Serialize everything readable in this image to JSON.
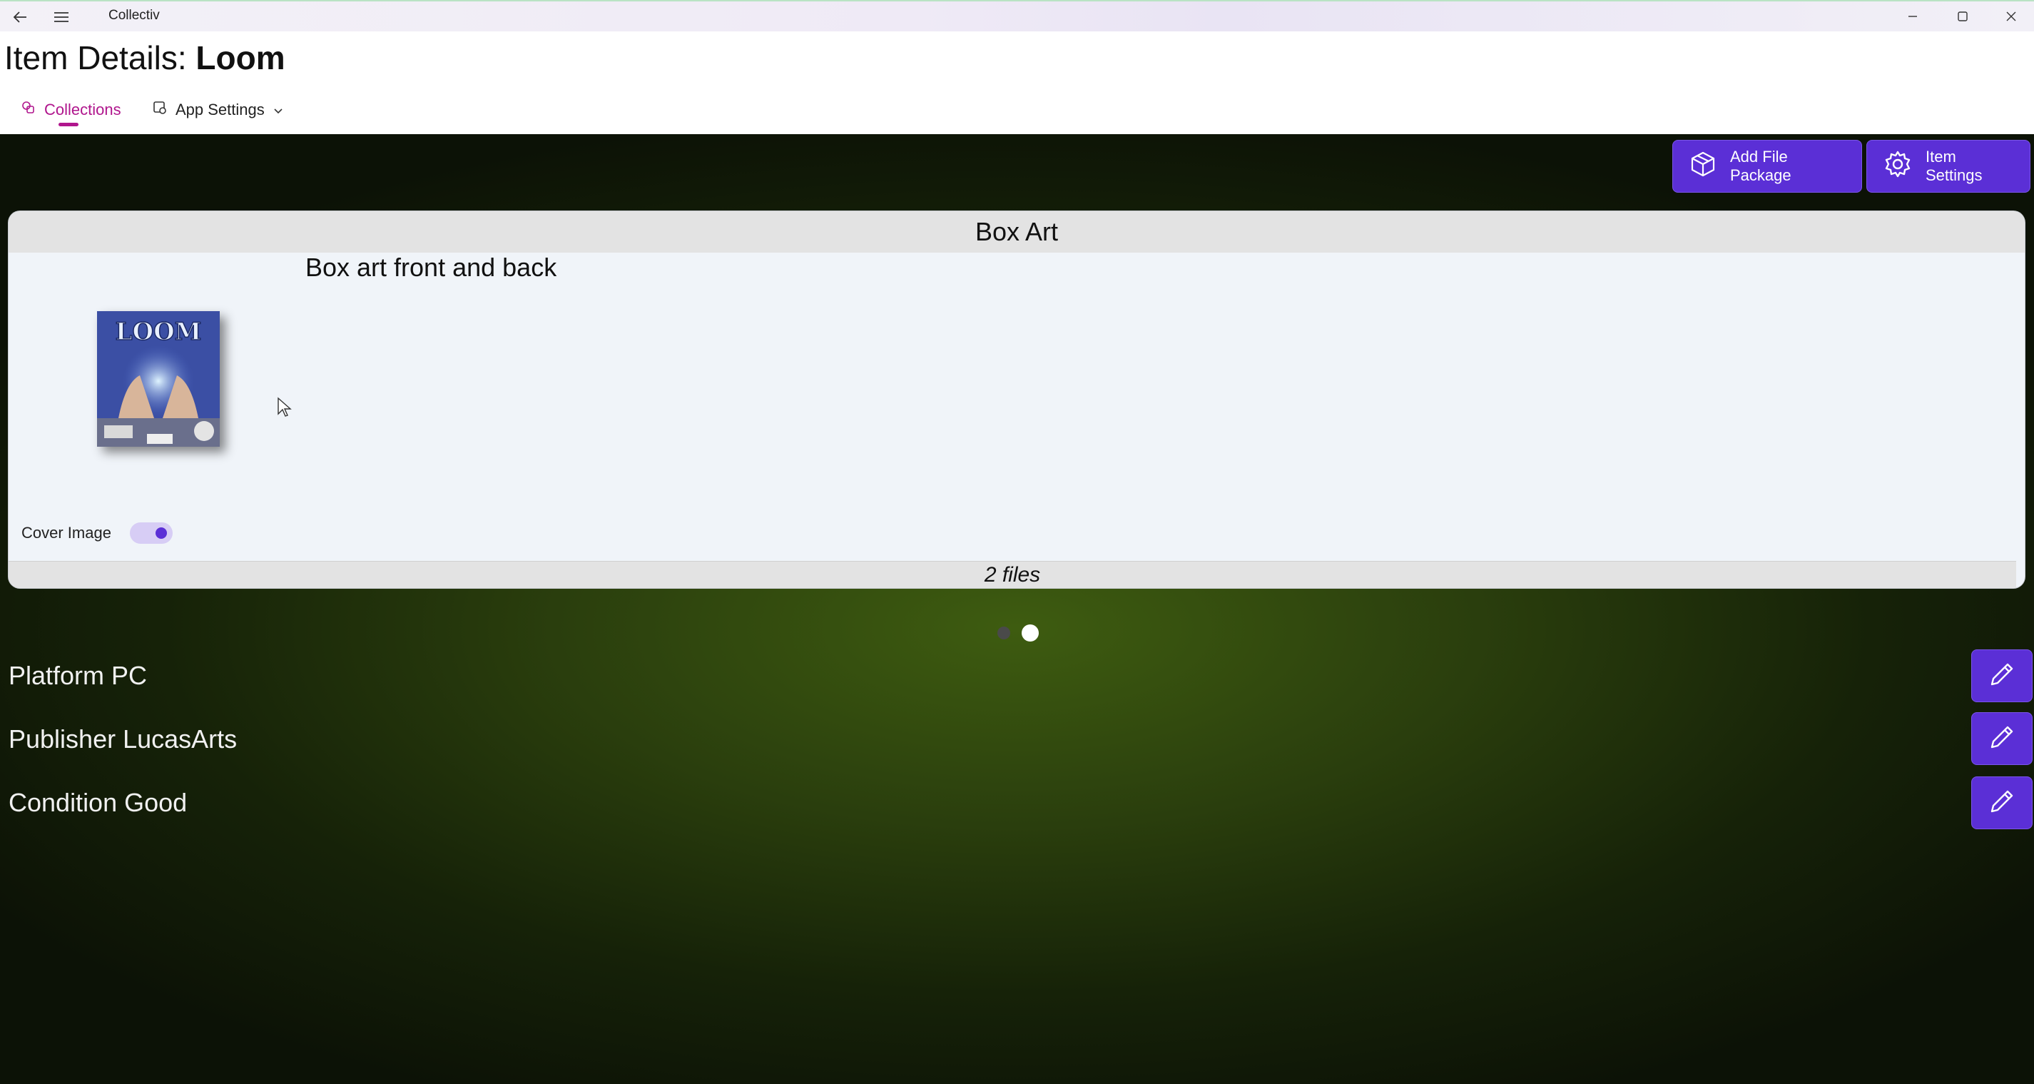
{
  "window": {
    "app_title": "Collectiv",
    "back_icon": "back-arrow-icon",
    "menu_icon": "hamburger-menu-icon",
    "controls": [
      "minimize-icon",
      "maximize-icon",
      "close-icon"
    ]
  },
  "header": {
    "title_prefix": "Item Details: ",
    "title_item": "Loom",
    "tabs": [
      {
        "label": "Collections",
        "icon": "collections-icon",
        "active": true
      },
      {
        "label": "App Settings",
        "icon": "settings-app-icon",
        "active": false
      }
    ]
  },
  "toolbar": {
    "add_file_package_label": "Add File Package",
    "item_settings_label": "Item Settings"
  },
  "file_package": {
    "title": "Box Art",
    "description": "Box art front and back",
    "cover_image_label": "Cover Image",
    "cover_image_on": true,
    "thumbnail_text": "LOOM",
    "file_count": "2 files"
  },
  "pager": {
    "count": 2,
    "active_index": 1
  },
  "properties": [
    {
      "text": "Platform PC"
    },
    {
      "text": "Publisher LucasArts"
    },
    {
      "text": "Condition Good"
    }
  ],
  "colors": {
    "accent": "#5b2fd6",
    "tab_active": "#b0168d",
    "background_center": "#3e5c10",
    "card_bg": "#f0f4f9"
  }
}
